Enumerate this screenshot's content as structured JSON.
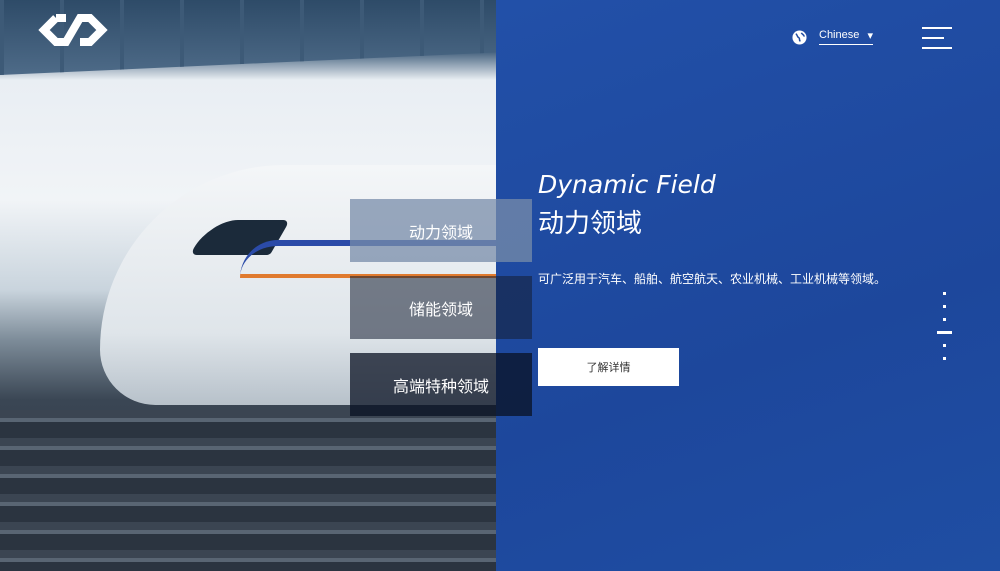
{
  "header": {
    "language": "Chinese",
    "icons": {
      "logo": "infinity-logo",
      "globe": "globe-icon",
      "dropdown": "caret-down-icon",
      "menu": "hamburger-menu-icon"
    }
  },
  "tabs": [
    {
      "label": "动力领域",
      "active": true
    },
    {
      "label": "储能领域"
    },
    {
      "label": "高端特种领域"
    }
  ],
  "hero": {
    "title_en": "Dynamic Field",
    "title_zh": "动力领域",
    "description": "可广泛用于汽车、船舶、航空航天、农业机械、工业机械等领域。",
    "button": "了解详情"
  },
  "pagination": {
    "total": 6,
    "active": 4
  },
  "colors": {
    "accent": "#1f4aa0"
  }
}
